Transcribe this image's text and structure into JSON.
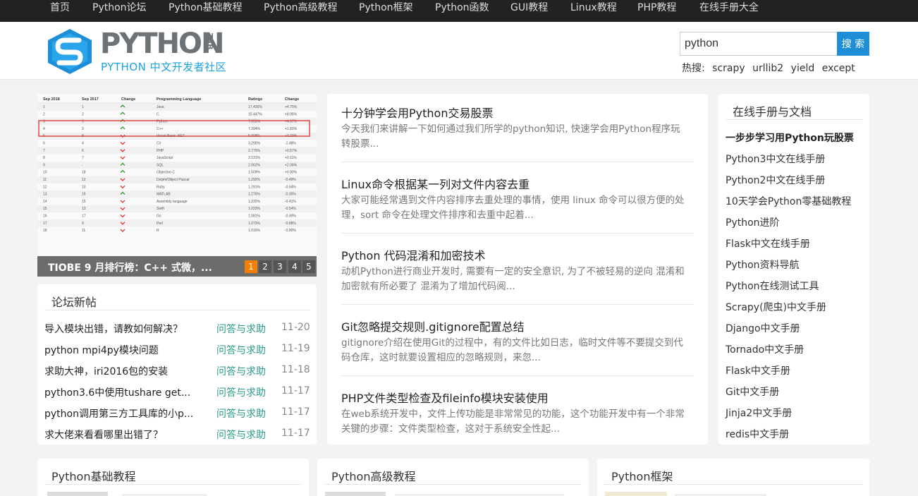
{
  "topnav": [
    "首页",
    "Python论坛",
    "Python基础教程",
    "Python高级教程",
    "Python框架",
    "Python函数",
    "GUI教程",
    "Linux教程",
    "PHP教程",
    "在线手册大全"
  ],
  "logo": {
    "word": "PYTHON",
    "tab": "TAB",
    "subtitle": "PYTHON 中文开发者社区"
  },
  "search": {
    "value": "python",
    "button": "搜 索",
    "hot_label": "热搜:",
    "hot": [
      "scrapy",
      "urllib2",
      "yield",
      "except"
    ]
  },
  "slider": {
    "caption": "TIOBE 9 月排行榜：C++ 式微，...",
    "pages": [
      "1",
      "2",
      "3",
      "4",
      "5"
    ],
    "table_headers": [
      "Sep 2018",
      "Sep 2017",
      "Change",
      "Programming Language",
      "Ratings",
      "Change"
    ],
    "table_rows": [
      [
        "1",
        "1",
        "",
        "Java",
        "17.436%",
        "+4.75%"
      ],
      [
        "2",
        "2",
        "",
        "C",
        "15.447%",
        "+8.06%"
      ],
      [
        "3",
        "5",
        "",
        "Python",
        "7.653%",
        "+4.67%"
      ],
      [
        "4",
        "3",
        "",
        "C++",
        "7.394%",
        "+1.83%"
      ],
      [
        "5",
        "8",
        "",
        "Visual Basic .NET",
        "5.308%",
        "+3.33%"
      ],
      [
        "6",
        "4",
        "",
        "C#",
        "3.295%",
        "-1.48%"
      ],
      [
        "7",
        "6",
        "",
        "PHP",
        "2.775%",
        "+0.57%"
      ],
      [
        "8",
        "7",
        "",
        "JavaScript",
        "2.131%",
        "+0.11%"
      ],
      [
        "9",
        "-",
        "",
        "SQL",
        "2.062%",
        "+2.06%"
      ],
      [
        "10",
        "18",
        "",
        "Objective-C",
        "1.509%",
        "+0.00%"
      ],
      [
        "11",
        "12",
        "",
        "Delphi/Object Pascal",
        "1.292%",
        "-0.49%"
      ],
      [
        "12",
        "10",
        "",
        "Ruby",
        "1.291%",
        "-0.64%"
      ],
      [
        "13",
        "16",
        "",
        "MATLAB",
        "1.276%",
        "-0.35%"
      ],
      [
        "14",
        "15",
        "",
        "Assembly language",
        "1.232%",
        "-0.41%"
      ],
      [
        "15",
        "13",
        "",
        "Swift",
        "1.223%",
        "-0.54%"
      ],
      [
        "16",
        "17",
        "",
        "Go",
        "1.081%",
        "-0.49%"
      ],
      [
        "17",
        "9",
        "",
        "Perl",
        "1.073%",
        "-0.88%"
      ],
      [
        "18",
        "11",
        "",
        "R",
        "1.016%",
        "-0.80%"
      ]
    ]
  },
  "forum": {
    "title": "论坛新帖",
    "rows": [
      {
        "title": "导入模块出错，请教如何解决？",
        "category": "问答与求助",
        "date": "11-20"
      },
      {
        "title": "python mpi4py模块问题",
        "category": "问答与求助",
        "date": "11-19"
      },
      {
        "title": "求助大神，iri2016包的安装",
        "category": "问答与求助",
        "date": "11-18"
      },
      {
        "title": "python3.6中使用tushare get...",
        "category": "问答与求助",
        "date": "11-17"
      },
      {
        "title": "python调用第三方工具库的小p...",
        "category": "问答与求助",
        "date": "11-17"
      },
      {
        "title": "求大佬来看看哪里出错了？",
        "category": "问答与求助",
        "date": "11-17"
      }
    ]
  },
  "articles": [
    {
      "title": "十分钟学会用Python交易股票",
      "summary": "今天我们来讲解一下如何通过我们所学的python知识, 快速学会用Python程序玩转股票..."
    },
    {
      "title": "Linux命令根据某一列对文件内容去重",
      "summary": "大家可能经常遇到文件内容排序去重处理的事情，使用 linux 命令可以很方便的处理，sort 命令在处理文件排序和去重中起着..."
    },
    {
      "title": "Python 代码混淆和加密技术",
      "summary": "动机Python进行商业开发时, 需要有一定的安全意识, 为了不被轻易的逆向 混淆和加密就有所必要了 混淆为了增加代码阅..."
    },
    {
      "title": "Git忽略提交规则.gitignore配置总结",
      "summary": "gitignore介绍在使用Git的过程中，有的文件比如日志，临时文件等不要提交到代码仓库，这时就要设置相应的忽略规则，来忽..."
    },
    {
      "title": "PHP文件类型检查及fileinfo模块安装使用",
      "summary": "在web系统开发中，文件上传功能是非常常见的功能，这个功能开发中有一个非常关键的步骤：文件类型检查，这对于系统安全性起..."
    }
  ],
  "manuals": {
    "title": "在线手册与文档",
    "items": [
      "一步步学习用Python玩股票",
      "Python3中文在线手册",
      "Python2中文在线手册",
      "10天学会Python零基础教程",
      "Python进阶",
      "Flask中文在线手册",
      "Python资料导航",
      "Python在线测试工具",
      "Scrapy(爬虫)中文手册",
      "Django中文手册",
      "Tornado中文手册",
      "Flask中文手册",
      "Git中文手册",
      "Jinja2中文手册",
      "redis中文手册"
    ]
  },
  "bottom_panels": [
    "Python基础教程",
    "Python高级教程",
    "Python框架"
  ],
  "colors": {
    "nav_bg": "#222222",
    "accent": "#1e8fd6",
    "category": "#2b9a8a",
    "pager_active": "#f77f00"
  }
}
